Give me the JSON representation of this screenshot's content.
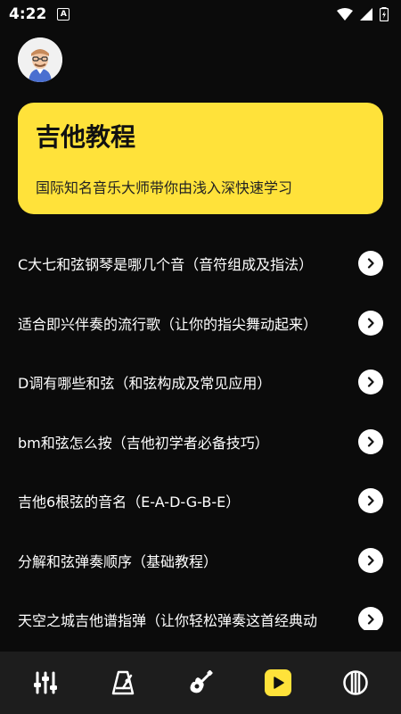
{
  "status": {
    "time": "4:22",
    "notification_badge": "A"
  },
  "hero": {
    "title": "吉他教程",
    "subtitle": "国际知名音乐大师带你由浅入深快速学习",
    "bg_color": "#ffe23a"
  },
  "list": {
    "items": [
      {
        "title": "C大七和弦钢琴是哪几个音（音符组成及指法）"
      },
      {
        "title": "适合即兴伴奏的流行歌（让你的指尖舞动起来）"
      },
      {
        "title": "D调有哪些和弦（和弦构成及常见应用）"
      },
      {
        "title": "bm和弦怎么按（吉他初学者必备技巧）"
      },
      {
        "title": "吉他6根弦的音名（E-A-D-G-B-E）"
      },
      {
        "title": "分解和弦弹奏顺序（基础教程）"
      },
      {
        "title": "天空之城吉他谱指弹（让你轻松弹奏这首经典动"
      }
    ]
  },
  "nav": {
    "items": [
      {
        "icon": "equalizer-icon"
      },
      {
        "icon": "metronome-icon"
      },
      {
        "icon": "guitar-icon"
      },
      {
        "icon": "play-icon",
        "active": true
      },
      {
        "icon": "strings-icon"
      }
    ],
    "active_color": "#ffe23a"
  }
}
